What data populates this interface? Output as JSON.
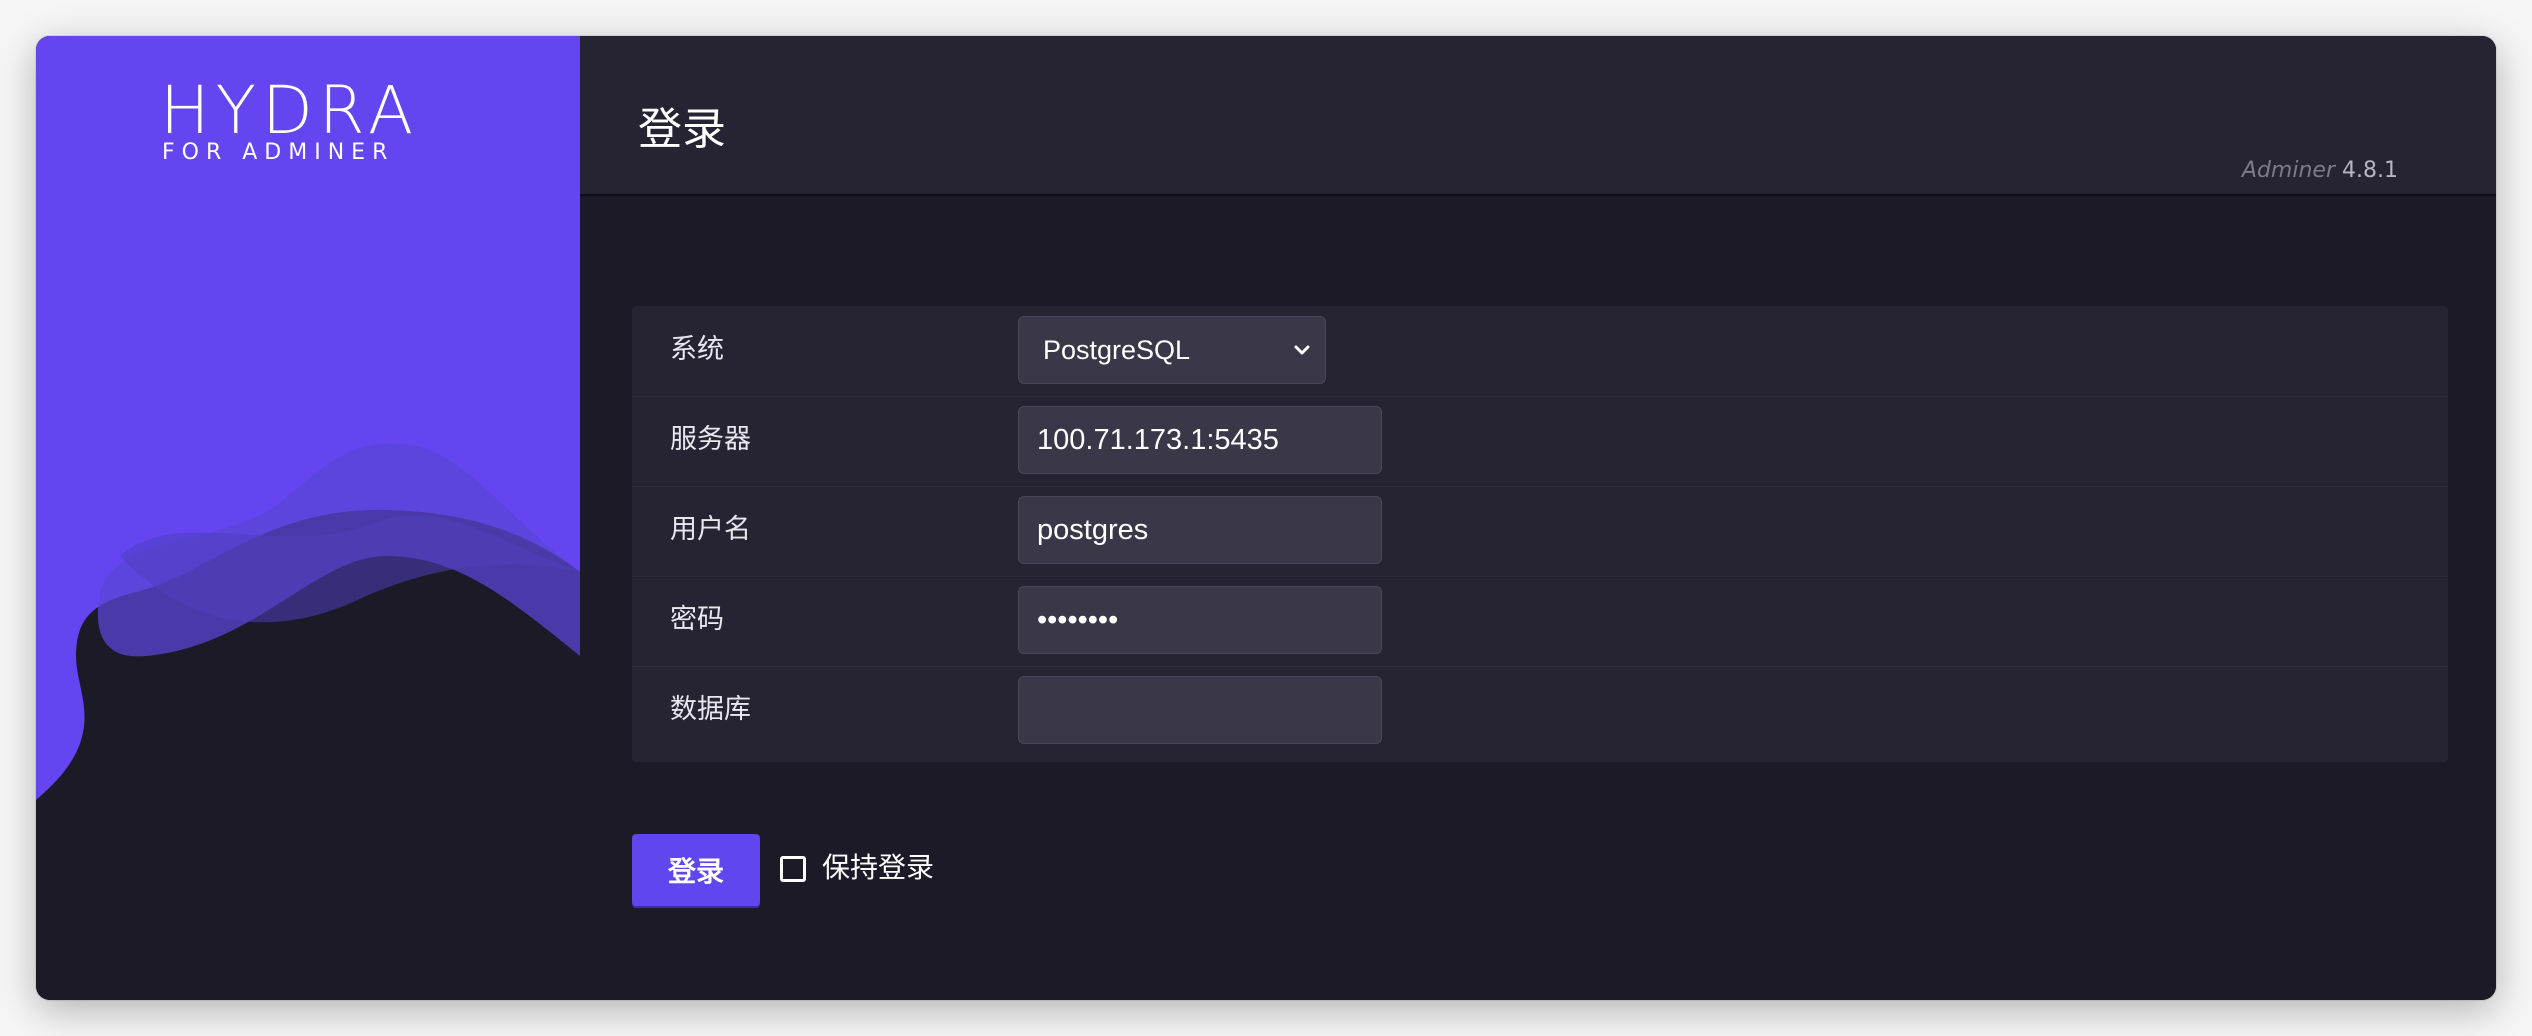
{
  "logo": {
    "word": "HYDRA",
    "subtitle": "FOR ADMINER"
  },
  "header": {
    "title": "登录",
    "version_brand": "Adminer",
    "version_number": "4.8.1"
  },
  "form": {
    "fields": [
      {
        "label": "系统",
        "type": "select",
        "value": "PostgreSQL"
      },
      {
        "label": "服务器",
        "type": "text",
        "value": "100.71.173.1:5435"
      },
      {
        "label": "用户名",
        "type": "text",
        "value": "postgres"
      },
      {
        "label": "密码",
        "type": "password",
        "value": "••••••••"
      },
      {
        "label": "数据库",
        "type": "text",
        "value": ""
      }
    ]
  },
  "actions": {
    "login_label": "登录",
    "remember_label": "保持登录",
    "remember_checked": false
  },
  "colors": {
    "accent": "#6046ee",
    "sidebar_purple": "#6445ef",
    "background": "#1c1a27",
    "panel": "#262433",
    "input": "#3a3848"
  },
  "icons": {
    "select_chevron": "chevron-down-icon",
    "checkbox": "checkbox-icon"
  }
}
